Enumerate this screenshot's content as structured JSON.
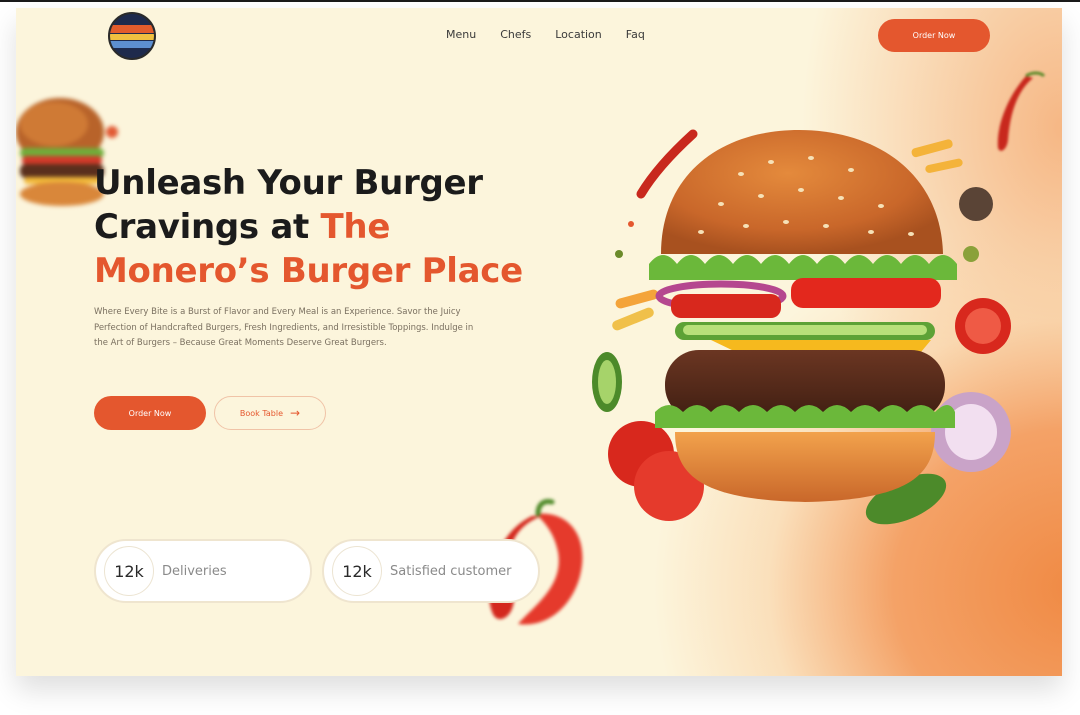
{
  "brand": {
    "logo_icon": "restaurant-logo-badge"
  },
  "nav": {
    "links": [
      "Menu",
      "Chefs",
      "Location",
      "Faq"
    ],
    "order_label": "Order Now"
  },
  "hero": {
    "title_line1": "Unleash Your Burger",
    "title_line2_plain": "Cravings at ",
    "title_line2_accent": "The",
    "title_line3_accent": "Monero’s Burger Place",
    "description": "Where Every Bite is a Burst of Flavor and Every Meal is an Experience. Savor the Juicy Perfection of Handcrafted Burgers, Fresh Ingredients, and Irresistible Toppings. Indulge in the Art of Burgers – Because Great Moments Deserve Great Burgers.",
    "order_label": "Order Now",
    "book_label": "Book Table",
    "book_icon": "arrow-right-icon"
  },
  "stats": [
    {
      "value": "12k",
      "label": "Deliveries"
    },
    {
      "value": "12k",
      "label": "Satisfied customer"
    }
  ],
  "colors": {
    "accent": "#e4572e",
    "background": "#fcf5dc",
    "glow": "#f08a44",
    "text_dark": "#1b1b1b"
  }
}
